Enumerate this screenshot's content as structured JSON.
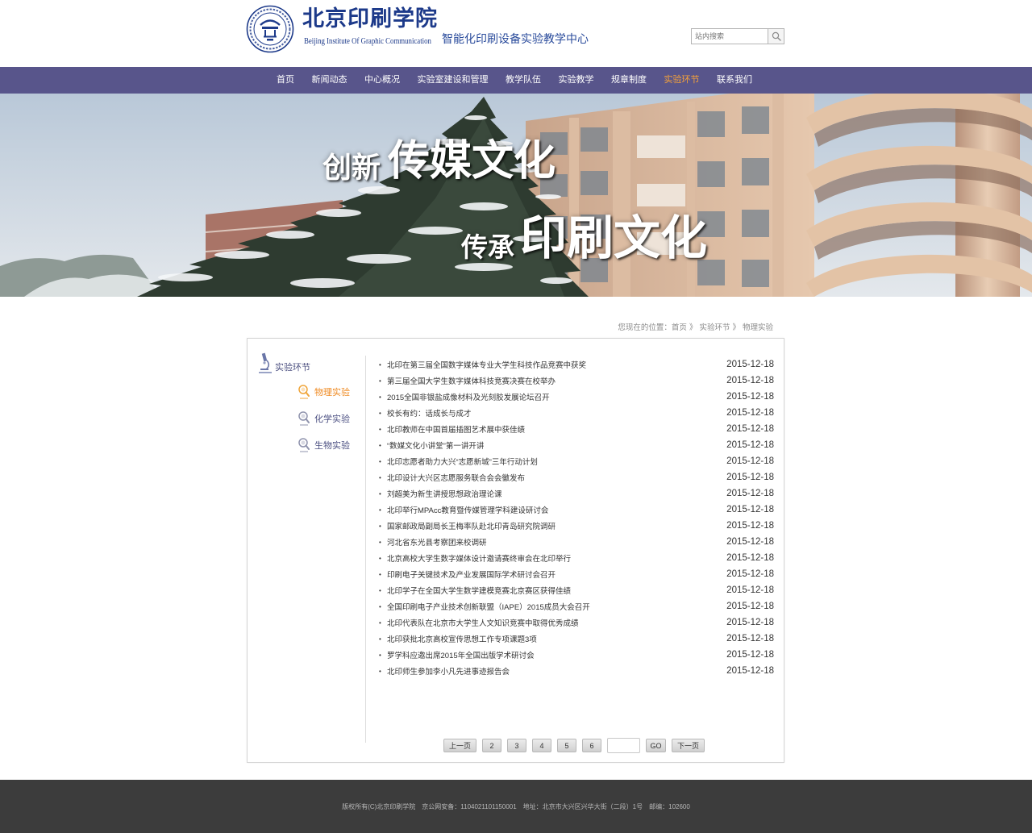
{
  "colors": {
    "brand_blue": "#1d3a8a",
    "nav_bg": "#58558b",
    "nav_active": "#f5a13a",
    "sidebar_active": "#ef8a22",
    "footer_bg": "#3c3c3c"
  },
  "header": {
    "logo_icon": "school-seal-icon",
    "school_name_cn": "北京印刷学院",
    "school_name_en": "Beijing Institute Of Graphic Communication",
    "center_name": "智能化印刷设备实验教学中心",
    "search": {
      "placeholder": "站内搜索",
      "value": "",
      "icon": "search-icon"
    }
  },
  "nav": {
    "active_index": 7,
    "items": [
      {
        "label": "首页"
      },
      {
        "label": "新闻动态"
      },
      {
        "label": "中心概况"
      },
      {
        "label": "实验室建设和管理"
      },
      {
        "label": "教学队伍"
      },
      {
        "label": "实验教学"
      },
      {
        "label": "规章制度"
      },
      {
        "label": "实验环节"
      },
      {
        "label": "联系我们"
      }
    ]
  },
  "banner": {
    "line1_small": "创新",
    "line1_large": "传媒文化",
    "line2_small": "传承",
    "line2_large": "印刷文化"
  },
  "breadcrumb": {
    "prefix": "您现在的位置：",
    "separator": "》",
    "items": [
      "首页",
      "实验环节",
      "物理实验"
    ]
  },
  "sidebar": {
    "title": "实验环节",
    "title_icon": "microscope-icon",
    "active_index": 0,
    "items": [
      {
        "label": "物理实验",
        "icon": "magnifier-icon"
      },
      {
        "label": "化学实验",
        "icon": "magnifier-icon"
      },
      {
        "label": "生物实验",
        "icon": "magnifier-icon"
      }
    ]
  },
  "news": [
    {
      "title": "北印在第三届全国数字媒体专业大学生科技作品竞赛中获奖",
      "date": "2015-12-18"
    },
    {
      "title": "第三届全国大学生数字媒体科技竞赛决赛在校举办",
      "date": "2015-12-18"
    },
    {
      "title": "2015全国非银盐成像材料及光刻胶发展论坛召开",
      "date": "2015-12-18"
    },
    {
      "title": "校长有约：话成长与成才",
      "date": "2015-12-18"
    },
    {
      "title": "北印教师在中国首届插图艺术展中获佳绩",
      "date": "2015-12-18"
    },
    {
      "title": "“数媒文化小讲堂”第一讲开讲",
      "date": "2015-12-18"
    },
    {
      "title": "北印志愿者助力大兴“志愿新城”三年行动计划",
      "date": "2015-12-18"
    },
    {
      "title": "北印设计大兴区志愿服务联合会会徽发布",
      "date": "2015-12-18"
    },
    {
      "title": "刘超美为新生讲授思想政治理论课",
      "date": "2015-12-18"
    },
    {
      "title": "北印举行MPAcc教育暨传媒管理学科建设研讨会",
      "date": "2015-12-18"
    },
    {
      "title": "国家邮政局副局长王梅率队赴北印青岛研究院调研",
      "date": "2015-12-18"
    },
    {
      "title": "河北省东光县考察团来校调研",
      "date": "2015-12-18"
    },
    {
      "title": "北京高校大学生数字媒体设计邀请赛终审会在北印举行",
      "date": "2015-12-18"
    },
    {
      "title": "印刷电子关键技术及产业发展国际学术研讨会召开",
      "date": "2015-12-18"
    },
    {
      "title": "北印学子在全国大学生数学建模竞赛北京赛区获得佳绩",
      "date": "2015-12-18"
    },
    {
      "title": "全国印刷电子产业技术创新联盟（IAPE）2015成员大会召开",
      "date": "2015-12-18"
    },
    {
      "title": "北印代表队在北京市大学生人文知识竞赛中取得优秀成绩",
      "date": "2015-12-18"
    },
    {
      "title": "北印获批北京高校宣传思想工作专项课题3项",
      "date": "2015-12-18"
    },
    {
      "title": "罗学科应邀出席2015年全国出版学术研讨会",
      "date": "2015-12-18"
    },
    {
      "title": "北印师生参加李小凡先进事迹报告会",
      "date": "2015-12-18"
    }
  ],
  "pagination": {
    "prev": "上一页",
    "pages": [
      "2",
      "3",
      "4",
      "5",
      "6"
    ],
    "jump_value": "",
    "go": "GO",
    "next": "下一页"
  },
  "footer": {
    "copyright": "版权所有(C)北京印刷学院",
    "icp": "京公网安备：1104021101150001",
    "address": "地址：北京市大兴区兴华大街（二段）1号",
    "postcode": "邮编：102600"
  }
}
